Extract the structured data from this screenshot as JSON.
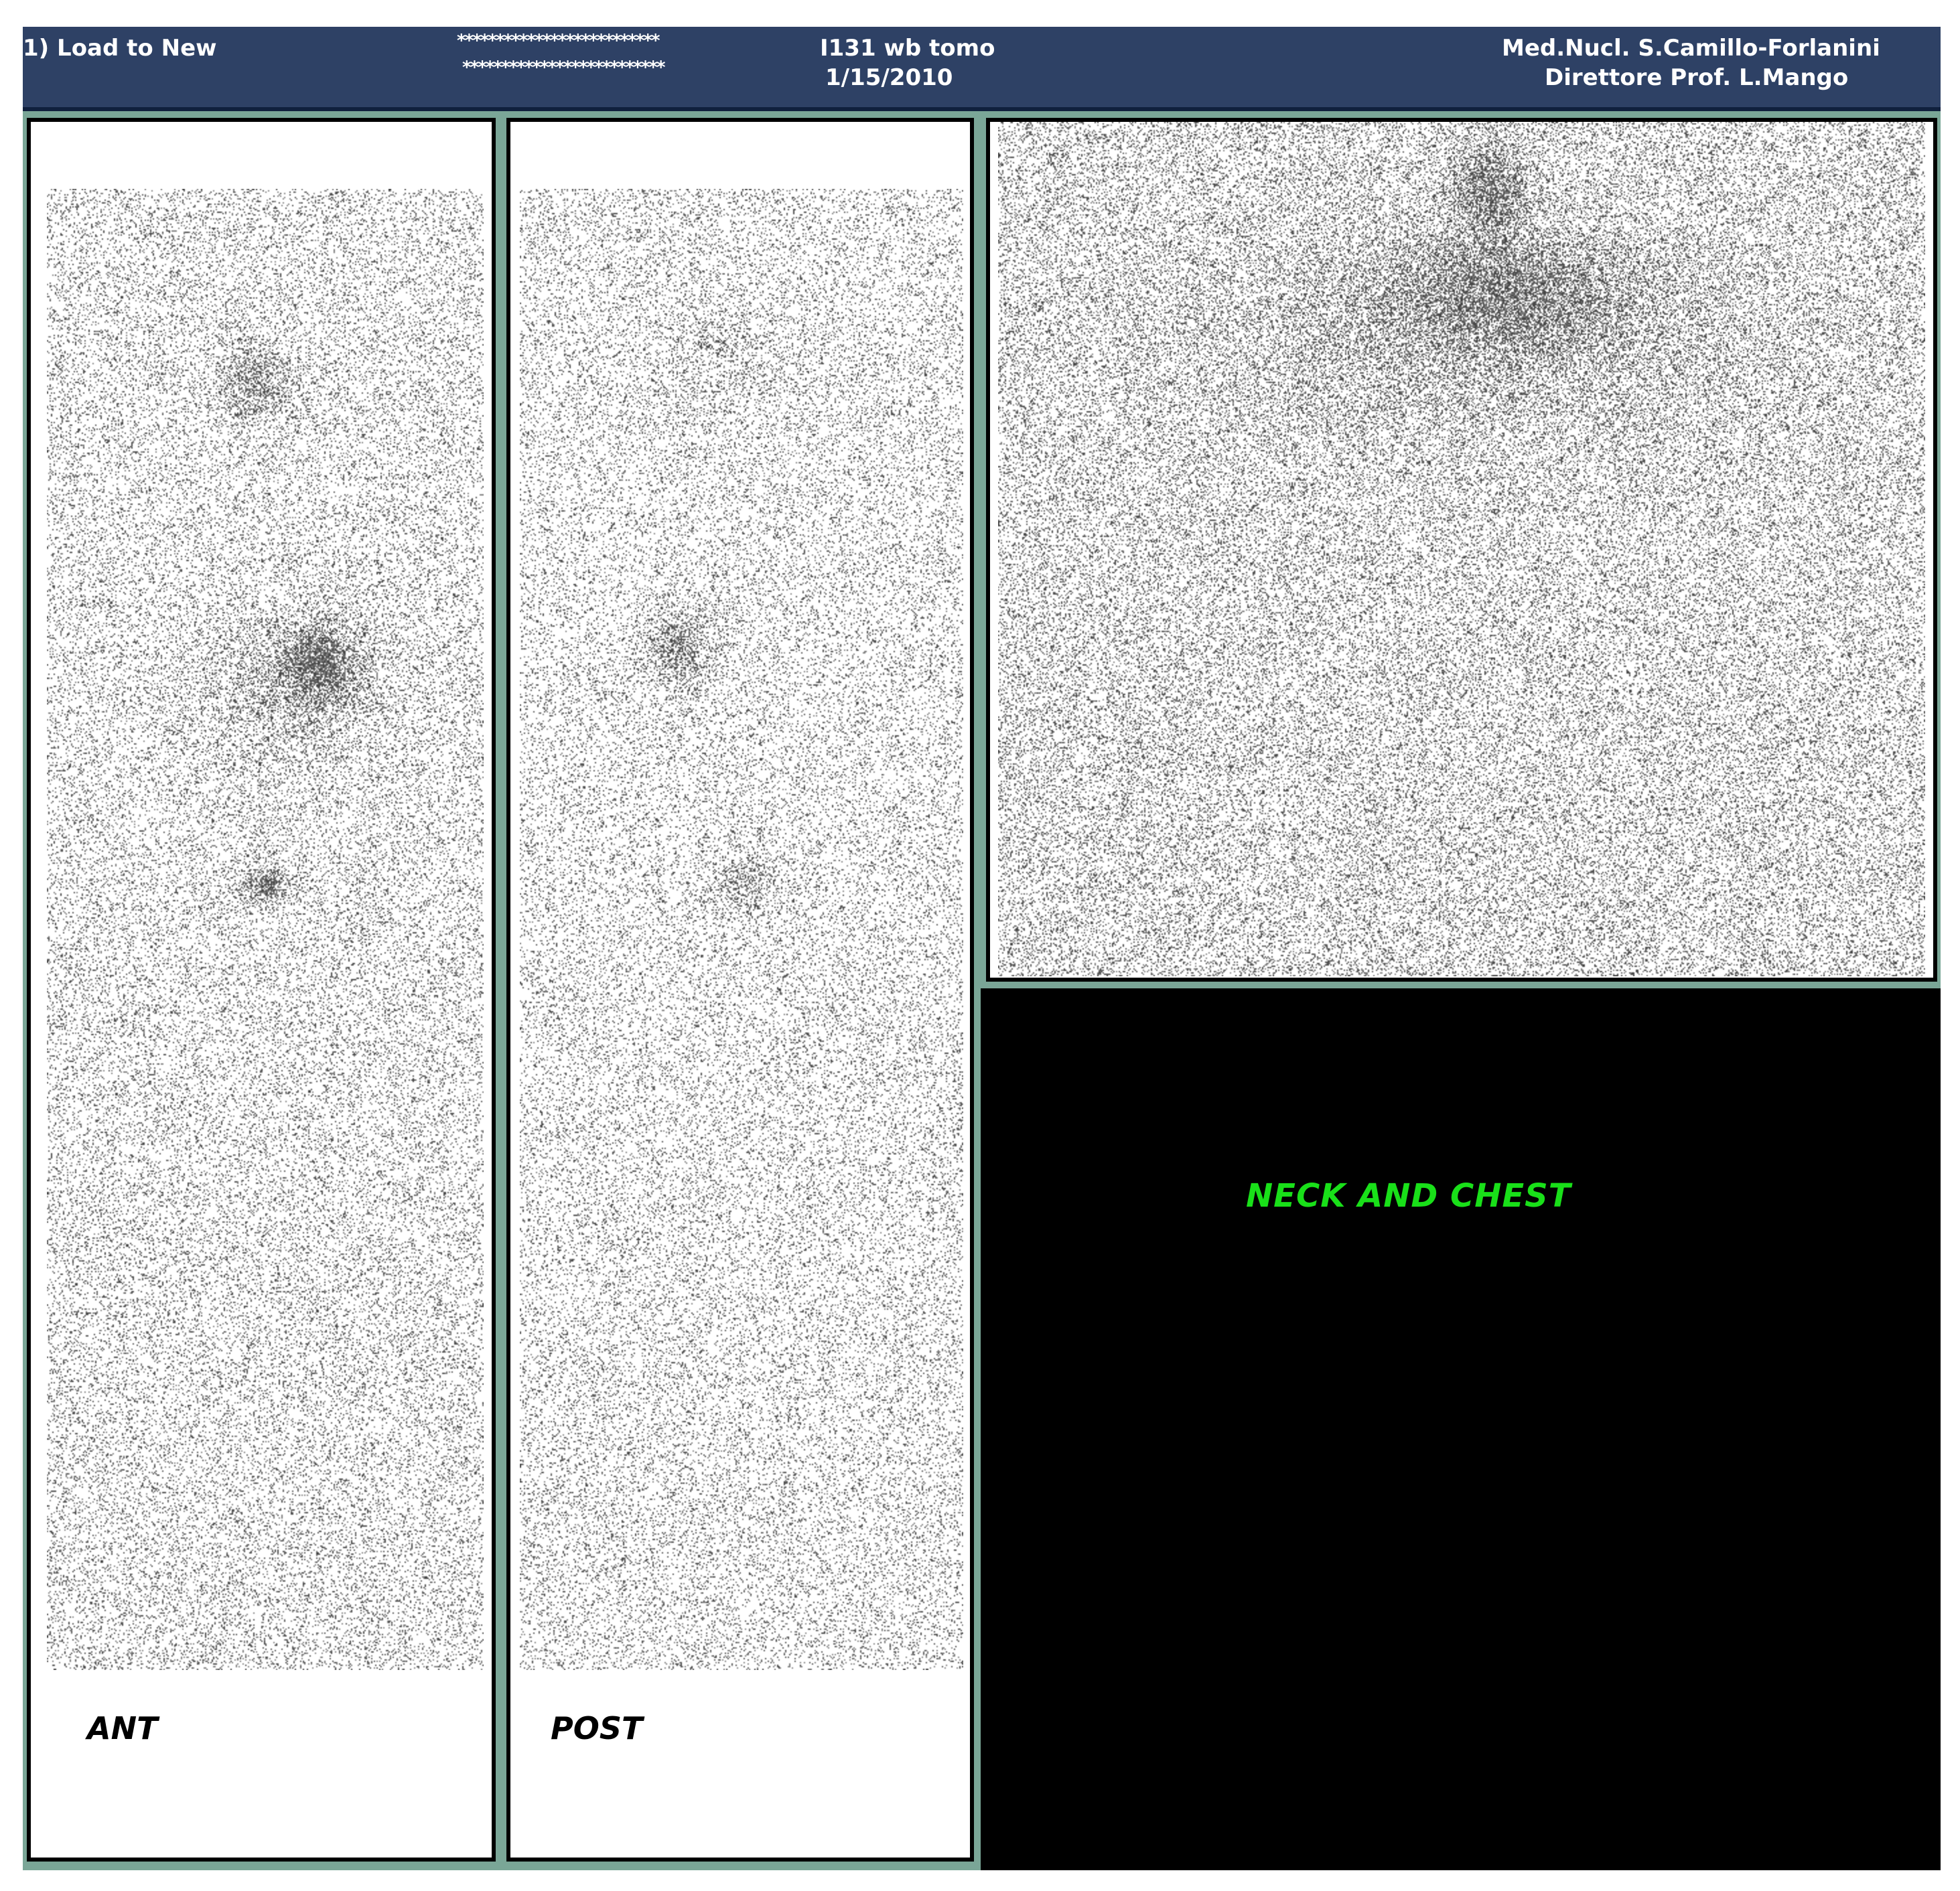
{
  "header": {
    "load_label": "1) Load to New",
    "patient_line1": "**************************",
    "patient_line2": "**************************",
    "study": "I131 wb tomo",
    "date": "1/15/2010",
    "institution": "Med.Nucl. S.Camillo-Forlanini",
    "director": "Direttore Prof. L.Mango"
  },
  "views": {
    "anterior": "ANT",
    "posterior": "POST",
    "spot": "NECK AND CHEST"
  },
  "colors": {
    "titlebar": "#2e4165",
    "frame": "#7aa697",
    "spot_label": "#19e019"
  }
}
